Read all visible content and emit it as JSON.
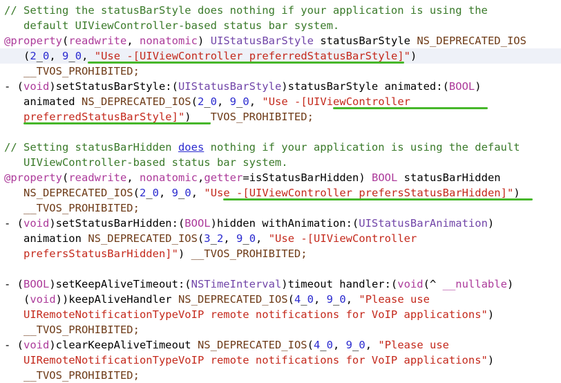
{
  "lines": [
    {
      "indent": 0,
      "highlight": false,
      "tokens": [
        [
          "// Setting the statusBarStyle does nothing if your application is using the",
          "comment"
        ]
      ]
    },
    {
      "indent": 3,
      "highlight": false,
      "tokens": [
        [
          "default UIViewController-based status bar system.",
          "comment"
        ]
      ]
    },
    {
      "indent": 0,
      "highlight": false,
      "tokens": [
        [
          "@property",
          "kw"
        ],
        [
          "(",
          "plain"
        ],
        [
          "readwrite",
          "kw"
        ],
        [
          ", ",
          "plain"
        ],
        [
          "nonatomic",
          "kw"
        ],
        [
          ") ",
          "plain"
        ],
        [
          "UIStatusBarStyle",
          "type"
        ],
        [
          " statusBarStyle ",
          "plain"
        ],
        [
          "NS_DEPRECATED_IOS",
          "macro"
        ]
      ]
    },
    {
      "indent": 3,
      "highlight": true,
      "tokens": [
        [
          "(",
          "plain"
        ],
        [
          "2",
          "num"
        ],
        [
          "_",
          "plain"
        ],
        [
          "0",
          "num"
        ],
        [
          ", ",
          "plain"
        ],
        [
          "9",
          "num"
        ],
        [
          "_",
          "plain"
        ],
        [
          "0",
          "num"
        ],
        [
          ", ",
          "plain"
        ],
        [
          "\"Use -[UIViewController preferredStatusBarStyle]\"",
          "str"
        ],
        [
          ")",
          "plain"
        ]
      ]
    },
    {
      "indent": 3,
      "highlight": false,
      "tokens": [
        [
          "__TVOS_PROHIBITED;",
          "macro"
        ]
      ]
    },
    {
      "indent": 0,
      "highlight": false,
      "tokens": [
        [
          "- (",
          "plain"
        ],
        [
          "void",
          "kw"
        ],
        [
          ")setStatusBarStyle:(",
          "plain"
        ],
        [
          "UIStatusBarStyle",
          "type"
        ],
        [
          ")statusBarStyle animated:(",
          "plain"
        ],
        [
          "BOOL",
          "kw"
        ],
        [
          ")",
          "plain"
        ]
      ]
    },
    {
      "indent": 3,
      "highlight": false,
      "tokens": [
        [
          "animated ",
          "plain"
        ],
        [
          "NS_DEPRECATED_IOS",
          "macro"
        ],
        [
          "(",
          "plain"
        ],
        [
          "2",
          "num"
        ],
        [
          "_",
          "plain"
        ],
        [
          "0",
          "num"
        ],
        [
          ", ",
          "plain"
        ],
        [
          "9",
          "num"
        ],
        [
          "_",
          "plain"
        ],
        [
          "0",
          "num"
        ],
        [
          ", ",
          "plain"
        ],
        [
          "\"Use -[UIViewController",
          "str"
        ]
      ]
    },
    {
      "indent": 3,
      "highlight": false,
      "tokens": [
        [
          "preferredStatusBarStyle]\"",
          "str"
        ],
        [
          ") ",
          "plain"
        ],
        [
          "__TVOS_PROHIBITED;",
          "macro"
        ]
      ]
    },
    {
      "indent": 0,
      "highlight": false,
      "tokens": []
    },
    {
      "indent": 0,
      "highlight": false,
      "tokens": [
        [
          "// Setting statusBarHidden ",
          "comment"
        ],
        [
          "does",
          "link"
        ],
        [
          " nothing if your application is using the default",
          "comment"
        ]
      ]
    },
    {
      "indent": 3,
      "highlight": false,
      "tokens": [
        [
          "UIViewController-based status bar system.",
          "comment"
        ]
      ]
    },
    {
      "indent": 0,
      "highlight": false,
      "tokens": [
        [
          "@property",
          "kw"
        ],
        [
          "(",
          "plain"
        ],
        [
          "readwrite",
          "kw"
        ],
        [
          ", ",
          "plain"
        ],
        [
          "nonatomic",
          "kw"
        ],
        [
          ",",
          "plain"
        ],
        [
          "getter",
          "kw"
        ],
        [
          "=isStatusBarHidden) ",
          "plain"
        ],
        [
          "BOOL",
          "kw"
        ],
        [
          " statusBarHidden",
          "plain"
        ]
      ]
    },
    {
      "indent": 3,
      "highlight": false,
      "tokens": [
        [
          "NS_DEPRECATED_IOS",
          "macro"
        ],
        [
          "(",
          "plain"
        ],
        [
          "2",
          "num"
        ],
        [
          "_",
          "plain"
        ],
        [
          "0",
          "num"
        ],
        [
          ", ",
          "plain"
        ],
        [
          "9",
          "num"
        ],
        [
          "_",
          "plain"
        ],
        [
          "0",
          "num"
        ],
        [
          ", ",
          "plain"
        ],
        [
          "\"Use -[UIViewController prefersStatusBarHidden]\"",
          "str"
        ],
        [
          ")",
          "plain"
        ]
      ]
    },
    {
      "indent": 3,
      "highlight": false,
      "tokens": [
        [
          "__TVOS_PROHIBITED;",
          "macro"
        ]
      ]
    },
    {
      "indent": 0,
      "highlight": false,
      "tokens": [
        [
          "- (",
          "plain"
        ],
        [
          "void",
          "kw"
        ],
        [
          ")setStatusBarHidden:(",
          "plain"
        ],
        [
          "BOOL",
          "kw"
        ],
        [
          ")hidden withAnimation:(",
          "plain"
        ],
        [
          "UIStatusBarAnimation",
          "type"
        ],
        [
          ")",
          "plain"
        ]
      ]
    },
    {
      "indent": 3,
      "highlight": false,
      "tokens": [
        [
          "animation ",
          "plain"
        ],
        [
          "NS_DEPRECATED_IOS",
          "macro"
        ],
        [
          "(",
          "plain"
        ],
        [
          "3",
          "num"
        ],
        [
          "_",
          "plain"
        ],
        [
          "2",
          "num"
        ],
        [
          ", ",
          "plain"
        ],
        [
          "9",
          "num"
        ],
        [
          "_",
          "plain"
        ],
        [
          "0",
          "num"
        ],
        [
          ", ",
          "plain"
        ],
        [
          "\"Use -[UIViewController",
          "str"
        ]
      ]
    },
    {
      "indent": 3,
      "highlight": false,
      "tokens": [
        [
          "prefersStatusBarHidden]\"",
          "str"
        ],
        [
          ") ",
          "plain"
        ],
        [
          "__TVOS_PROHIBITED;",
          "macro"
        ]
      ]
    },
    {
      "indent": 0,
      "highlight": false,
      "tokens": []
    },
    {
      "indent": 0,
      "highlight": false,
      "tokens": [
        [
          "- (",
          "plain"
        ],
        [
          "BOOL",
          "kw"
        ],
        [
          ")setKeepAliveTimeout:(",
          "plain"
        ],
        [
          "NSTimeInterval",
          "type"
        ],
        [
          ")timeout handler:(",
          "plain"
        ],
        [
          "void",
          "kw"
        ],
        [
          "(^ ",
          "plain"
        ],
        [
          "__nullable",
          "kw"
        ],
        [
          ")",
          "plain"
        ]
      ]
    },
    {
      "indent": 3,
      "highlight": false,
      "tokens": [
        [
          "(",
          "plain"
        ],
        [
          "void",
          "kw"
        ],
        [
          "))keepAliveHandler ",
          "plain"
        ],
        [
          "NS_DEPRECATED_IOS",
          "macro"
        ],
        [
          "(",
          "plain"
        ],
        [
          "4",
          "num"
        ],
        [
          "_",
          "plain"
        ],
        [
          "0",
          "num"
        ],
        [
          ", ",
          "plain"
        ],
        [
          "9",
          "num"
        ],
        [
          "_",
          "plain"
        ],
        [
          "0",
          "num"
        ],
        [
          ", ",
          "plain"
        ],
        [
          "\"Please use",
          "str"
        ]
      ]
    },
    {
      "indent": 3,
      "highlight": false,
      "tokens": [
        [
          "UIRemoteNotificationTypeVoIP remote notifications for VoIP applications\"",
          "str"
        ],
        [
          ")",
          "plain"
        ]
      ]
    },
    {
      "indent": 3,
      "highlight": false,
      "tokens": [
        [
          "__TVOS_PROHIBITED;",
          "macro"
        ]
      ]
    },
    {
      "indent": 0,
      "highlight": false,
      "tokens": [
        [
          "- (",
          "plain"
        ],
        [
          "void",
          "kw"
        ],
        [
          ")clearKeepAliveTimeout ",
          "plain"
        ],
        [
          "NS_DEPRECATED_IOS",
          "macro"
        ],
        [
          "(",
          "plain"
        ],
        [
          "4",
          "num"
        ],
        [
          "_",
          "plain"
        ],
        [
          "0",
          "num"
        ],
        [
          ", ",
          "plain"
        ],
        [
          "9",
          "num"
        ],
        [
          "_",
          "plain"
        ],
        [
          "0",
          "num"
        ],
        [
          ", ",
          "plain"
        ],
        [
          "\"Please use",
          "str"
        ]
      ]
    },
    {
      "indent": 3,
      "highlight": false,
      "tokens": [
        [
          "UIRemoteNotificationTypeVoIP remote notifications for VoIP applications\"",
          "str"
        ],
        [
          ")",
          "plain"
        ]
      ]
    },
    {
      "indent": 3,
      "highlight": false,
      "tokens": [
        [
          "__TVOS_PROHIBITED;",
          "macro"
        ]
      ]
    }
  ],
  "annotations": [
    {
      "line": 3,
      "from_col": 13,
      "to_col": 62
    },
    {
      "line": 6,
      "from_col": 51,
      "to_col": 75
    },
    {
      "line": 7,
      "from_col": 3,
      "to_col": 32
    },
    {
      "line": 12,
      "from_col": 34,
      "to_col": 82
    }
  ],
  "colors": {
    "comment": "#3a7a2a",
    "keyword": "#ac3a9a",
    "type": "#7145a8",
    "number": "#2a2acf",
    "string": "#c4291c",
    "macro": "#6e3b18",
    "underline": "#46b72a",
    "line_highlight": "#eef1f8"
  }
}
